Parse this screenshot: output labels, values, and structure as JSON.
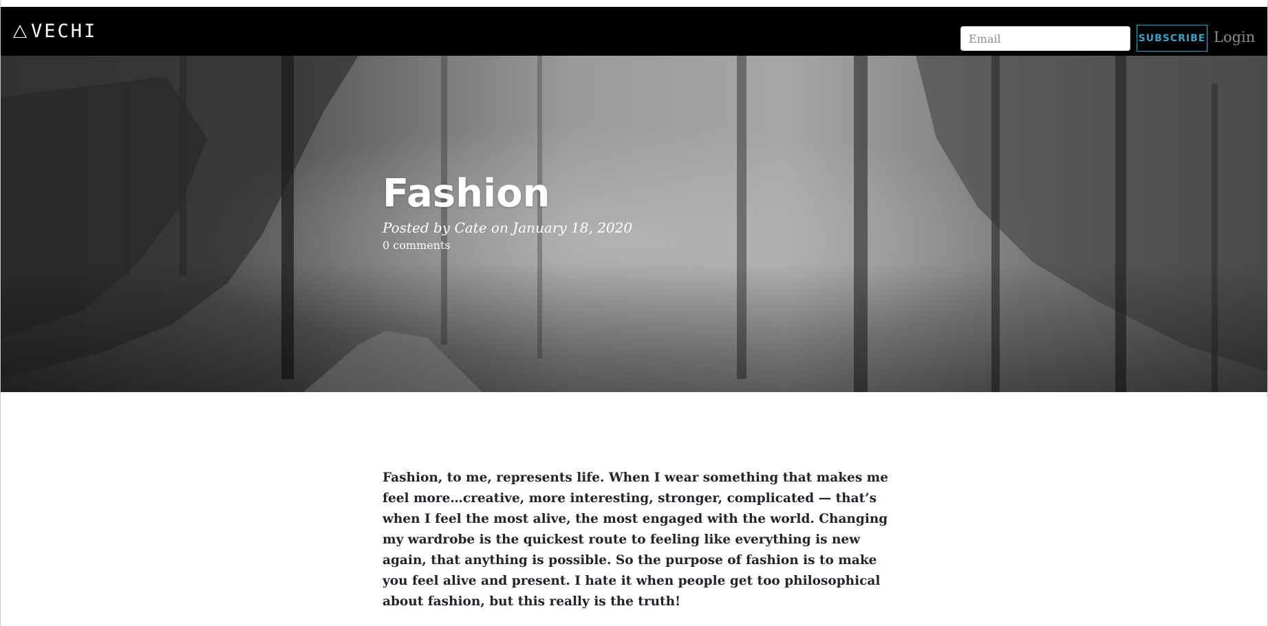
{
  "brand": {
    "name": "VECHI",
    "logo_icon": "triangle-outline-icon"
  },
  "nav": {
    "email_placeholder": "Email",
    "email_value": "",
    "subscribe_label": "SUBSCRIBE",
    "login_label": "Login"
  },
  "colors": {
    "navbar_bg": "#000000",
    "accent": "#2fa4c8",
    "body_text": "#212529"
  },
  "post": {
    "title": "Fashion",
    "meta": "Posted by Cate on January 18, 2020",
    "comments": "0 comments",
    "body": "Fashion, to me, represents life. When I wear something that makes me feel more…creative, more interesting, stronger, complicated — that’s when I feel the most alive, the most engaged with the world. Changing my wardrobe is the quickest route to feeling like everything is new again, that anything is possible. So the purpose of fashion is to make you feel alive and present. I hate it when people get too philosophical about fashion, but this really is the truth!"
  }
}
